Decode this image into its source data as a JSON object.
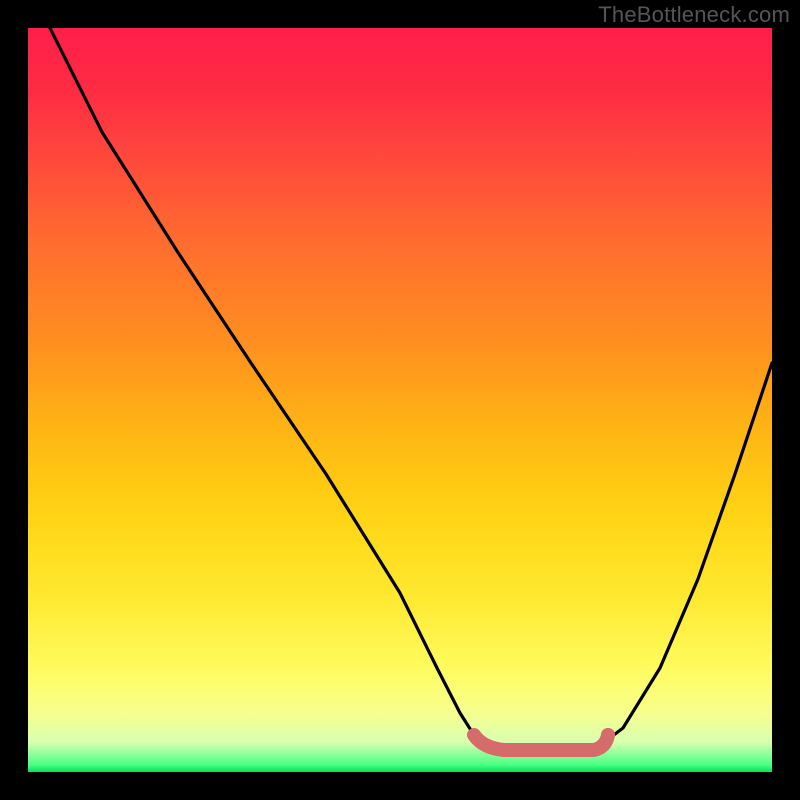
{
  "watermark": "TheBottleneck.com",
  "chart_data": {
    "type": "line",
    "title": "",
    "xlabel": "",
    "ylabel": "",
    "xlim": [
      0,
      100
    ],
    "ylim": [
      0,
      100
    ],
    "series": [
      {
        "name": "bottleneck-curve",
        "x": [
          3,
          10,
          20,
          30,
          40,
          50,
          55,
          58,
          60,
          64,
          68,
          72,
          76,
          80,
          85,
          90,
          95,
          100
        ],
        "y": [
          100,
          86,
          70,
          55,
          40,
          24,
          14,
          8,
          5,
          3,
          3,
          3,
          3,
          6,
          14,
          26,
          40,
          55
        ],
        "color": "#000000"
      },
      {
        "name": "optimal-range-marker",
        "x": [
          60,
          64,
          68,
          72,
          76,
          78
        ],
        "y": [
          5,
          3,
          3,
          3,
          3,
          5
        ],
        "color": "#d66b6b"
      }
    ],
    "gradient_stops": [
      {
        "pos": 0,
        "color": "#ff1f4b"
      },
      {
        "pos": 18,
        "color": "#ff4a3b"
      },
      {
        "pos": 42,
        "color": "#ff8e20"
      },
      {
        "pos": 66,
        "color": "#ffd515"
      },
      {
        "pos": 86,
        "color": "#fffb5e"
      },
      {
        "pos": 96,
        "color": "#d8ffb0"
      },
      {
        "pos": 100,
        "color": "#00e25f"
      }
    ]
  }
}
